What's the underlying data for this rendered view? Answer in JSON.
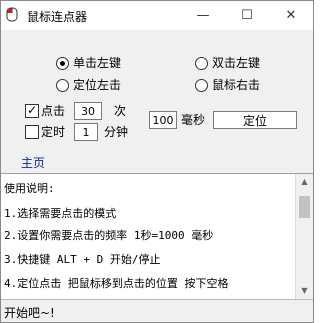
{
  "window": {
    "title": "鼠标连点器",
    "controls": {
      "minimize": "—",
      "maximize": "☐",
      "close": "✕"
    }
  },
  "click_type": {
    "single_left": {
      "label": "单击左键",
      "selected": true
    },
    "double_left": {
      "label": "双击左键",
      "selected": false
    },
    "locate_left": {
      "label": "定位左击",
      "selected": false
    },
    "mouse_right": {
      "label": "鼠标右击",
      "selected": false
    }
  },
  "settings": {
    "click_count": {
      "label": "点击",
      "checked": true,
      "value": "30",
      "unit": "次"
    },
    "timer": {
      "label": "定时",
      "checked": false,
      "value": "1",
      "unit": "分钟"
    },
    "interval": {
      "value": "100",
      "unit": "毫秒"
    },
    "locate_button": "定位"
  },
  "home_link": "主页",
  "instructions": [
    "使用说明:",
    "1.选择需要点击的模式",
    "2.设置你需要点击的频率 1秒=1000 毫秒",
    "3.快捷键 ALT + D 开始/停止",
    "4.定位点击 把鼠标移到点击的位置 按下空格"
  ],
  "status_text": "开始吧~!",
  "colors": {
    "link": "#0a2a9a",
    "background": "#f0f0f0",
    "icon_red": "#cc2222"
  }
}
